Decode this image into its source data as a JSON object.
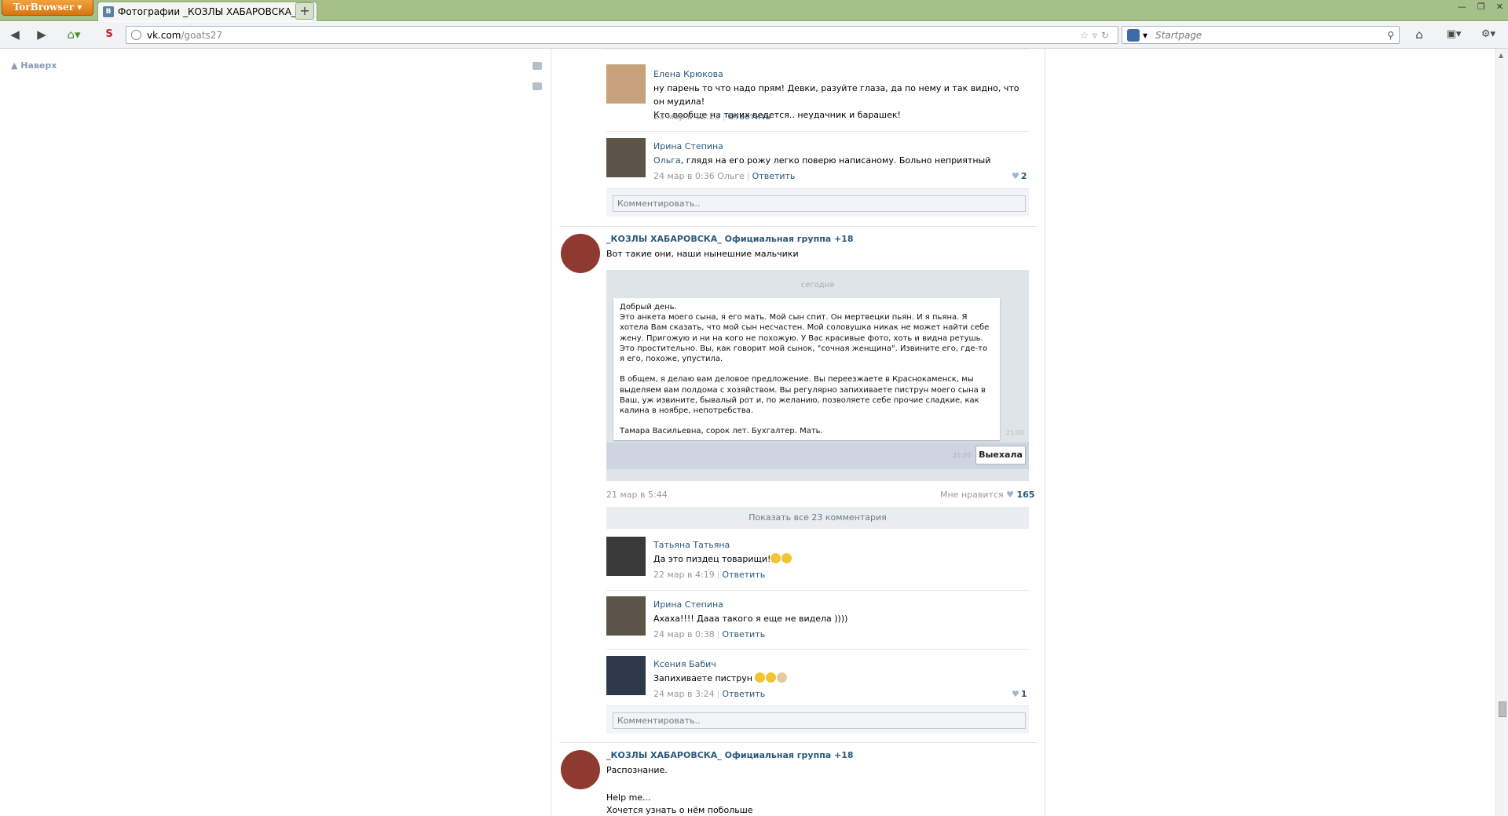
{
  "browser": {
    "tor_label": "TorBrowser",
    "tab_title": "Фотографии _КОЗЛЫ ХАБАРОВСКА_ О...",
    "tab_icon": "В",
    "url_host": "vk.com",
    "url_path": "/goats27",
    "search_placeholder": "Startpage",
    "newtab": "+"
  },
  "left": {
    "back_top": "Наверх"
  },
  "top_comments": [
    {
      "name": "Елена Крюкова",
      "text": "ну парень то что надо прям! Девки, разуйте глаза, да по нему и так видно, что он мудила!\nКто вообще на таких ведется.. неудачник и барашек!",
      "date": "23 мар в 12:23",
      "reply": "Ответить"
    },
    {
      "name": "Ирина Степина",
      "text_pre": "Ольга",
      "text": ", глядя на его рожу легко поверю написаному. Больно неприятный",
      "date": "24 мар в 0:36 Ольге",
      "reply": "Ответить",
      "likes": "2"
    }
  ],
  "comment_placeholder": "Комментировать..",
  "post1": {
    "author": "_КОЗЛЫ ХАБАРОВСКА_ Официальная группа +18",
    "text": "Вот такие они, наши нынешние мальчики",
    "photo": {
      "day": "сегодня",
      "message": "Добрый день.\nЭто анкета моего сына, я его мать. Мой сын спит. Он мертвецки пьян. И я пьяна. Я хотела Вам сказать, что мой сын несчастен. Мой соловушка никак не может найти себе жену. Пригожую и ни на кого не похожую. У Вас красивые фото, хоть и видна ретушь. Это простительно. Вы, как говорит мой сынок, \"сочная женщина\". Извините его, где-то я его, похоже, упустила.\n\nВ общем, я делаю вам деловое предложение. Вы переезжаете в Краснокаменск, мы выделяем вам полдома с хозяйством. Вы регулярно запихиваете пиструн моего сына в Ваш, уж извините, бывалый рот и, по желанию, позволяете себе прочие сладкие, как калина в ноябре, непотребства.\n\nТамара Васильевна, сорок лет. Бухгалтер. Мать.",
      "time1": "21:00",
      "time2": "21:20",
      "answer": "Выехала"
    },
    "date": "21 мар в 5:44",
    "like_label": "Мне нравится",
    "likes": "165",
    "show_all": "Показать все 23 комментария",
    "comments": [
      {
        "name": "Татьяна Татьяна",
        "text": "Да это пиздец товарищи!",
        "date": "22 мар в 4:19",
        "reply": "Ответить"
      },
      {
        "name": "Ирина Степина",
        "text": "Ахаха!!!! Дааа такого я еще не видела ))))",
        "date": "24 мар в 0:38",
        "reply": "Ответить"
      },
      {
        "name": "Ксения Бабич",
        "text": "Запихиваете пиструн",
        "date": "24 мар в 3:24",
        "reply": "Ответить",
        "likes": "1"
      }
    ]
  },
  "post2": {
    "author": "_КОЗЛЫ ХАБАРОВСКА_ Официальная группа +18",
    "text1": "Распознание.",
    "text2": "Help me...",
    "text3": "Хочется узнать о нём побольше"
  }
}
